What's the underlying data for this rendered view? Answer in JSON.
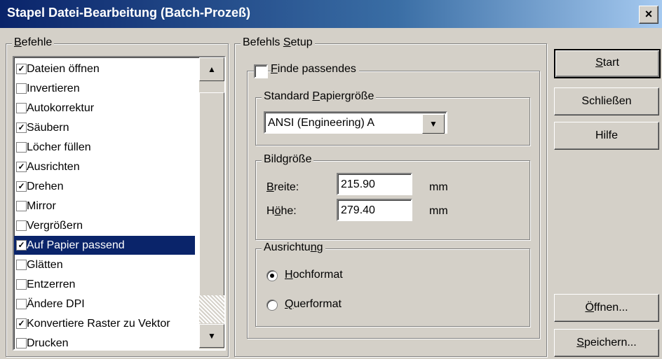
{
  "window": {
    "title": "Stapel Datei-Bearbeitung (Batch-Prozeß)",
    "close": "×"
  },
  "befehle": {
    "label": "Befehle",
    "items": [
      {
        "label": "Dateien öffnen",
        "checked": true
      },
      {
        "label": "Invertieren",
        "checked": false
      },
      {
        "label": "Autokorrektur",
        "checked": false
      },
      {
        "label": "Säubern",
        "checked": true
      },
      {
        "label": "Löcher füllen",
        "checked": false
      },
      {
        "label": "Ausrichten",
        "checked": true
      },
      {
        "label": "Drehen",
        "checked": true
      },
      {
        "label": "Mirror",
        "checked": false
      },
      {
        "label": "Vergrößern",
        "checked": false
      },
      {
        "label": "Auf Papier passend",
        "checked": true,
        "selected": true
      },
      {
        "label": "Glätten",
        "checked": false
      },
      {
        "label": "Entzerren",
        "checked": false
      },
      {
        "label": "Ändere DPI",
        "checked": false
      },
      {
        "label": "Konvertiere Raster zu Vektor",
        "checked": true
      },
      {
        "label": "Drucken",
        "checked": false
      }
    ],
    "scroll_up": "▲",
    "scroll_down": "▼"
  },
  "setup": {
    "label": "Befehls Setup",
    "finde_passendes": {
      "label": "Finde passendes",
      "checked": false
    },
    "papiergroesse": {
      "label": "Standard Papiergröße",
      "value": "ANSI (Engineering) A",
      "arrow": "▼"
    },
    "bildgroesse": {
      "label": "Bildgröße",
      "breite_label": "Breite:",
      "breite_value": "215.90",
      "breite_unit": "mm",
      "hoehe_label": "Höhe:",
      "hoehe_value": "279.40",
      "hoehe_unit": "mm"
    },
    "ausrichtung": {
      "label": "Ausrichtung",
      "hochformat": "Hochformat",
      "querformat": "Querformat",
      "selected": "Hochformat"
    }
  },
  "buttons": {
    "start": "Start",
    "schliessen": "Schließen",
    "hilfe": "Hilfe",
    "oeffnen": "Öffnen...",
    "speichern": "Speichern..."
  }
}
